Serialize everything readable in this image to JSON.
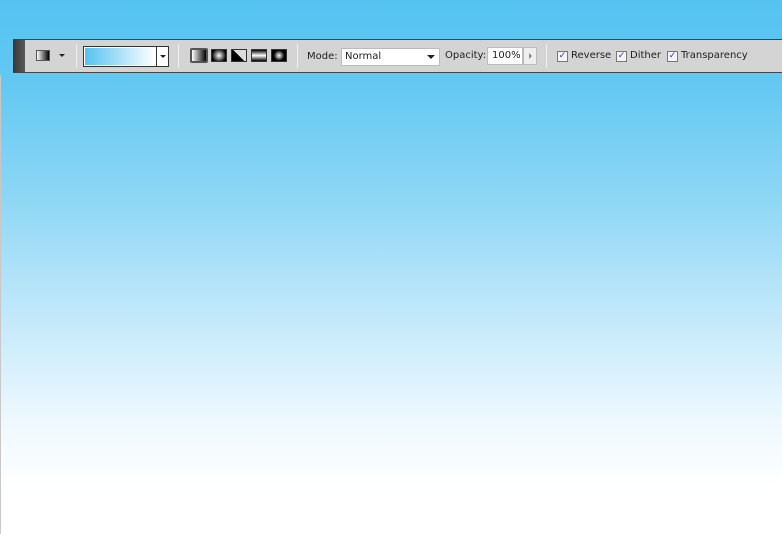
{
  "options_bar": {
    "tool_preset": {
      "icon": "gradient-tool-icon"
    },
    "gradient_picker": {
      "start_color": "#55c3f1",
      "end_color": "#ffffff"
    },
    "gradient_types": [
      {
        "name": "linear",
        "selected": true
      },
      {
        "name": "radial",
        "selected": false
      },
      {
        "name": "angle",
        "selected": false
      },
      {
        "name": "reflected",
        "selected": false
      },
      {
        "name": "diamond",
        "selected": false
      }
    ],
    "mode_label": "Mode:",
    "mode_value": "Normal",
    "opacity_label": "Opacity:",
    "opacity_value": "100%",
    "reverse": {
      "label": "Reverse",
      "checked": true
    },
    "dither": {
      "label": "Dither",
      "checked": true
    },
    "transparency": {
      "label": "Transparency",
      "checked": true
    },
    "check_mark": "✓"
  },
  "canvas": {
    "gradient_top": "#55c3f1",
    "gradient_bottom": "#ffffff"
  }
}
